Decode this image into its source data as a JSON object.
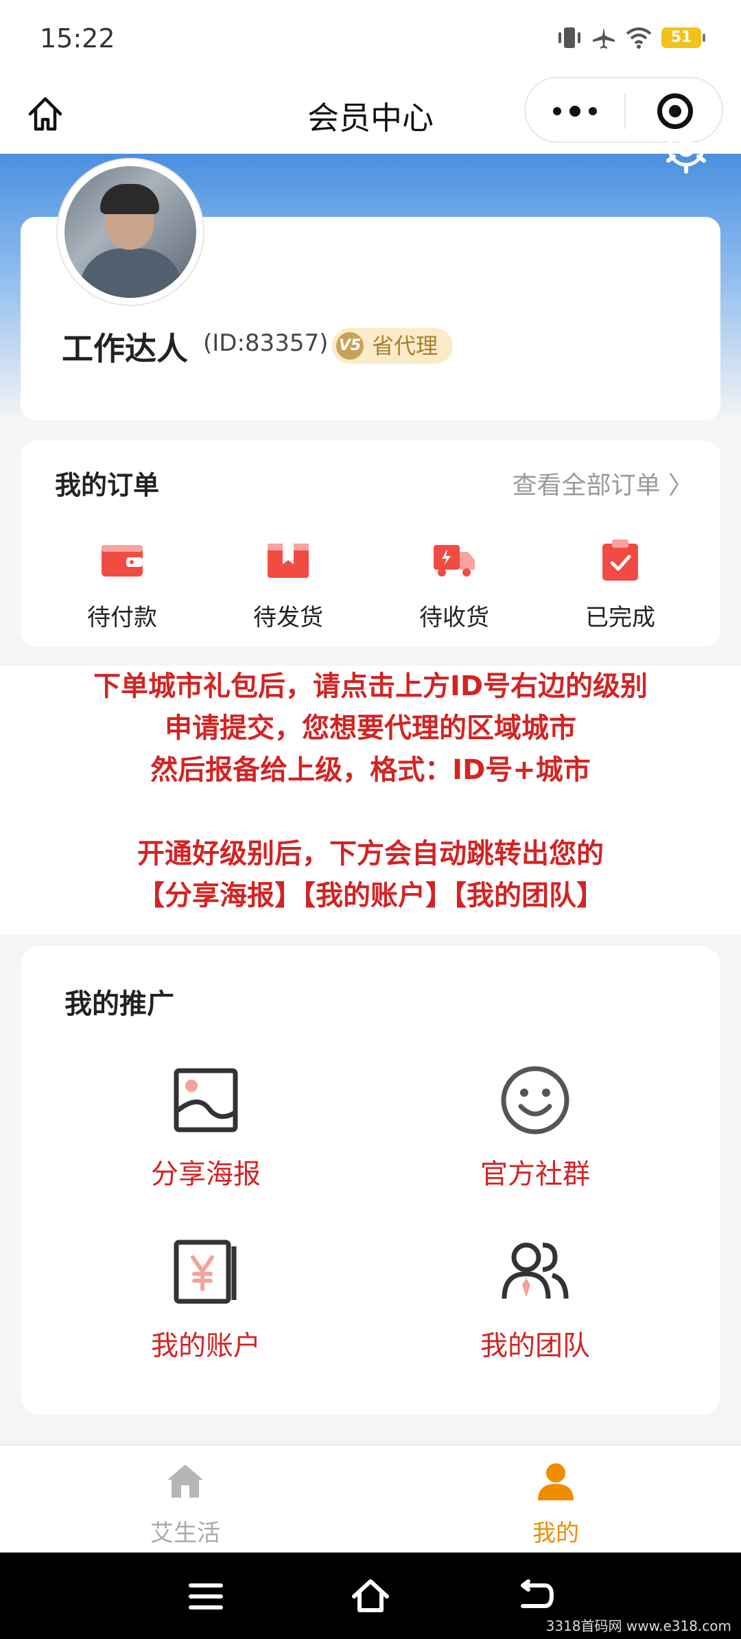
{
  "status_bar": {
    "time": "15:22",
    "battery": "51"
  },
  "nav": {
    "title": "会员中心"
  },
  "profile": {
    "name": "工作达人",
    "id_text": "(ID:83357)",
    "level_badge": "V5",
    "level": "省代理"
  },
  "orders": {
    "title": "我的订单",
    "view_all": "查看全部订单 〉",
    "items": [
      {
        "label": "待付款",
        "icon": "wallet-icon"
      },
      {
        "label": "待发货",
        "icon": "package-icon"
      },
      {
        "label": "待收货",
        "icon": "delivery-truck-icon"
      },
      {
        "label": "已完成",
        "icon": "clipboard-check-icon"
      }
    ]
  },
  "notice": {
    "lines": [
      "下单城市礼包后，请点击上方ID号右边的级别",
      "申请提交，您想要代理的区域城市",
      "然后报备给上级，格式：ID号+城市",
      "开通好级别后，下方会自动跳转出您的",
      "【分享海报】【我的账户】【我的团队】"
    ]
  },
  "promotion": {
    "title": "我的推广",
    "items": [
      {
        "label": "分享海报",
        "icon": "image-icon"
      },
      {
        "label": "官方社群",
        "icon": "smiley-icon"
      },
      {
        "label": "我的账户",
        "icon": "yen-ledger-icon"
      },
      {
        "label": "我的团队",
        "icon": "team-icon"
      }
    ]
  },
  "tabbar": {
    "items": [
      {
        "label": "艾生活",
        "icon": "home-icon",
        "active": false
      },
      {
        "label": "我的",
        "icon": "person-icon",
        "active": true
      }
    ]
  },
  "watermark": "3318首码网 www.e318.com",
  "colors": {
    "accent_red": "#d42323",
    "active_tab": "#f08c00",
    "inactive_tab": "#aaaaaa",
    "hero_blue": "#4a90e0"
  }
}
